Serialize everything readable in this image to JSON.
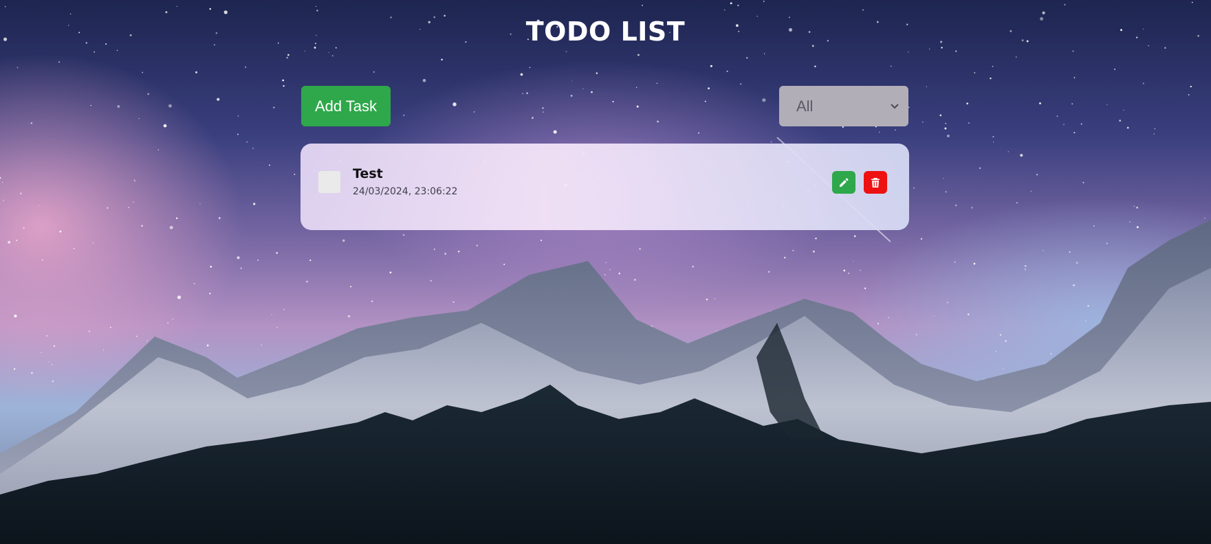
{
  "app": {
    "title": "TODO LIST"
  },
  "toolbar": {
    "add_task_label": "Add Task",
    "filter": {
      "selected": "All"
    }
  },
  "tasks": [
    {
      "title": "Test",
      "timestamp": "24/03/2024, 23:06:22",
      "completed": false
    }
  ],
  "icons": {
    "edit": "pencil-icon",
    "delete": "trash-icon",
    "dropdown": "chevron-down-icon"
  },
  "colors": {
    "primary_green": "#2ea84a",
    "delete_red": "#ee1111",
    "select_bg": "#b1aeb8"
  }
}
